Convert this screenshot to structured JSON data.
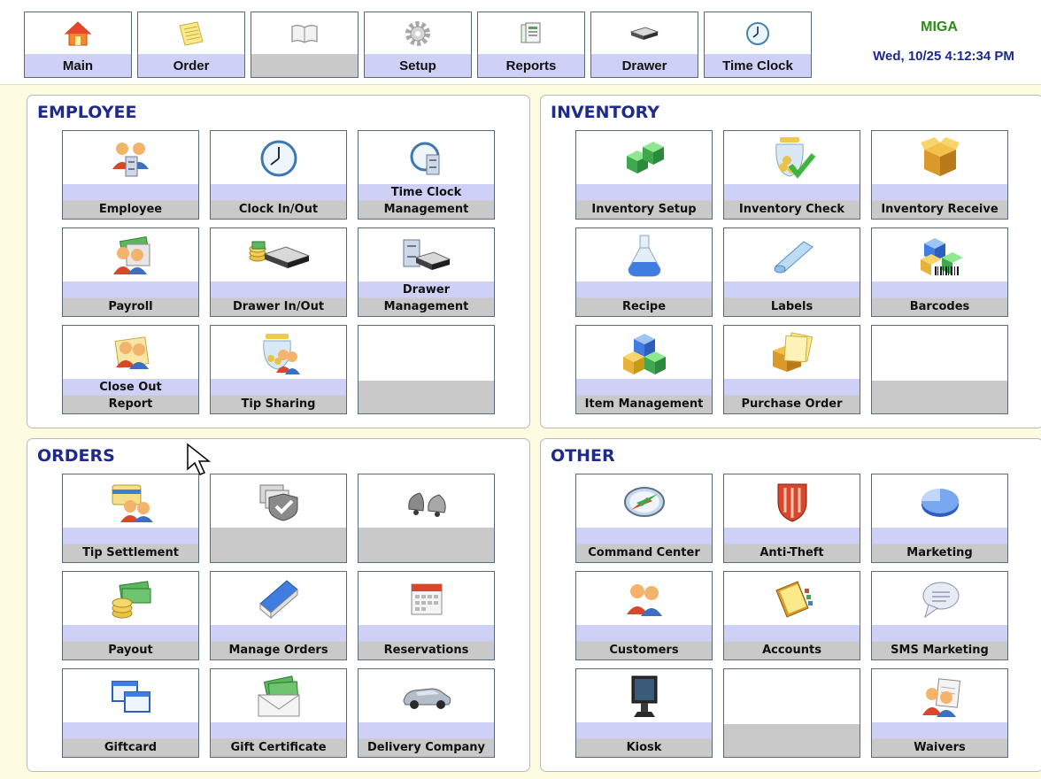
{
  "toolbar": {
    "buttons": [
      {
        "label": "Main"
      },
      {
        "label": "Order"
      },
      {
        "label": ""
      },
      {
        "label": "Setup"
      },
      {
        "label": "Reports"
      },
      {
        "label": "Drawer"
      },
      {
        "label": "Time Clock"
      }
    ],
    "store_name": "MIGA",
    "datetime": "Wed, 10/25 4:12:34 PM"
  },
  "sections": {
    "employee": {
      "title": "EMPLOYEE",
      "tiles": [
        "Employee",
        "Clock In/Out",
        "Time Clock\nManagement",
        "Payroll",
        "Drawer In/Out",
        "Drawer\nManagement",
        "Close Out\nReport",
        "Tip Sharing",
        ""
      ]
    },
    "inventory": {
      "title": "INVENTORY",
      "tiles": [
        "Inventory Setup",
        "Inventory Check",
        "Inventory Receive",
        "Recipe",
        "Labels",
        "Barcodes",
        "Item Management",
        "Purchase Order",
        ""
      ]
    },
    "orders": {
      "title": "ORDERS",
      "tiles": [
        "Tip Settlement",
        "",
        "",
        "Payout",
        "Manage Orders",
        "Reservations",
        "Giftcard",
        "Gift Certificate",
        "Delivery Company"
      ]
    },
    "other": {
      "title": "OTHER",
      "tiles": [
        "Command Center",
        "Anti-Theft",
        "Marketing",
        "Customers",
        "Accounts",
        "SMS Marketing",
        "Kiosk",
        "",
        "Waivers"
      ]
    }
  },
  "colors": {
    "accent_band": "#cfd0f6",
    "grey_band": "#c9c9c9",
    "section_title": "#1e2a8c",
    "store_name": "#2e8b1a",
    "datetime": "#1a2a8a",
    "background": "#fdfbe0"
  }
}
